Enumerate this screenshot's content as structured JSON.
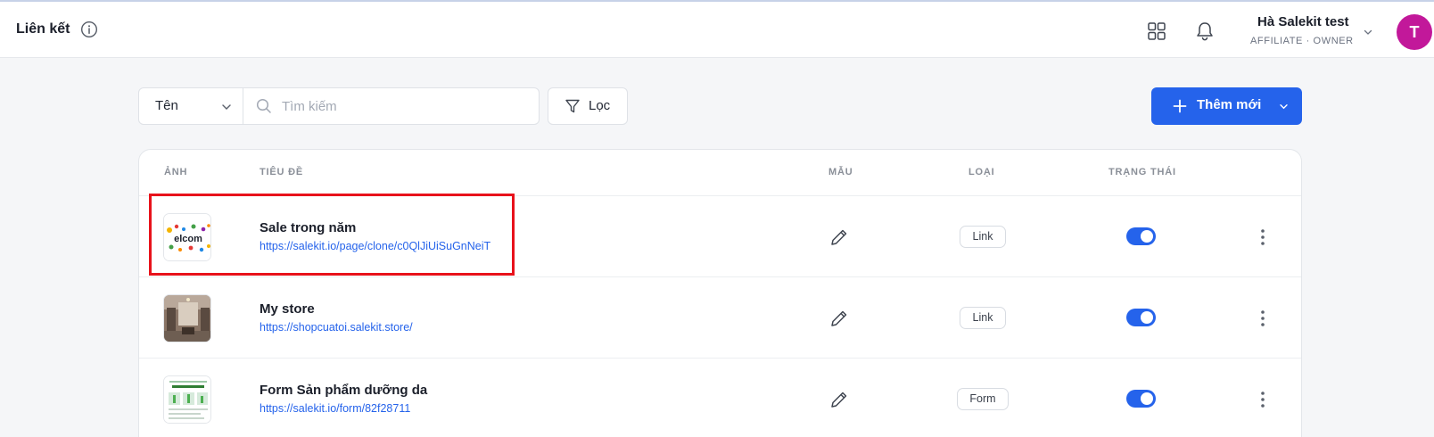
{
  "header": {
    "title": "Liên kết",
    "user": {
      "name": "Hà Salekit test",
      "role": "AFFILIATE  · OWNER",
      "avatar_letter": "T",
      "avatar_color": "#c2189a"
    }
  },
  "toolbar": {
    "field_select_value": "Tên",
    "search_placeholder": "Tìm kiếm",
    "filter_label": "Lọc",
    "add_label": "Thêm mới",
    "accent_color": "#2563eb"
  },
  "table": {
    "headers": {
      "image": "ẢNH",
      "title": "TIÊU ĐỀ",
      "template": "MẪU",
      "type": "LOẠI",
      "status": "TRẠNG THÁI"
    },
    "rows": [
      {
        "title": "Sale trong năm",
        "url": "https://salekit.io/page/clone/c0QlJiUiSuGnNeiT",
        "type": "Link",
        "enabled": true,
        "thumb": "welcome-banner",
        "highlighted": true
      },
      {
        "title": "My store",
        "url": "https://shopcuatoi.salekit.store/",
        "type": "Link",
        "enabled": true,
        "thumb": "store-interior"
      },
      {
        "title": "Form Sản phẩm dưỡng da",
        "url": "https://salekit.io/form/82f28711",
        "type": "Form",
        "enabled": true,
        "thumb": "form-preview"
      }
    ]
  },
  "icons": {
    "info": "info-icon",
    "apps": "grid-icon",
    "notifications": "bell-icon",
    "edit": "pencil-icon",
    "more": "more-vertical-icon",
    "search": "search-icon",
    "filter": "filter-icon",
    "add": "plus-icon"
  },
  "highlight_color": "#e8121b"
}
